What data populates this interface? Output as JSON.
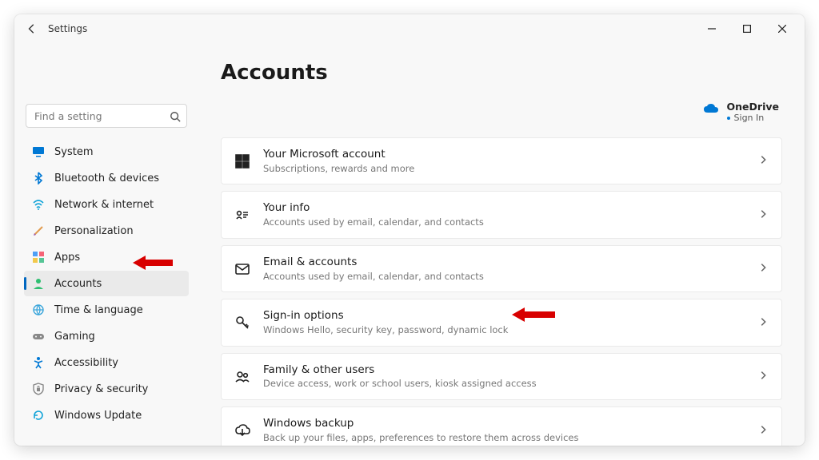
{
  "app": {
    "title": "Settings"
  },
  "search": {
    "placeholder": "Find a setting"
  },
  "sidebar": {
    "items": [
      {
        "label": "System"
      },
      {
        "label": "Bluetooth & devices"
      },
      {
        "label": "Network & internet"
      },
      {
        "label": "Personalization"
      },
      {
        "label": "Apps"
      },
      {
        "label": "Accounts"
      },
      {
        "label": "Time & language"
      },
      {
        "label": "Gaming"
      },
      {
        "label": "Accessibility"
      },
      {
        "label": "Privacy & security"
      },
      {
        "label": "Windows Update"
      }
    ],
    "active_index": 5
  },
  "page": {
    "title": "Accounts"
  },
  "onedrive": {
    "title": "OneDrive",
    "status": "Sign In"
  },
  "cards": [
    {
      "title": "Your Microsoft account",
      "sub": "Subscriptions, rewards and more"
    },
    {
      "title": "Your info",
      "sub": "Accounts used by email, calendar, and contacts"
    },
    {
      "title": "Email & accounts",
      "sub": "Accounts used by email, calendar, and contacts"
    },
    {
      "title": "Sign-in options",
      "sub": "Windows Hello, security key, password, dynamic lock"
    },
    {
      "title": "Family & other users",
      "sub": "Device access, work or school users, kiosk assigned access"
    },
    {
      "title": "Windows backup",
      "sub": "Back up your files, apps, preferences to restore them across devices"
    }
  ]
}
